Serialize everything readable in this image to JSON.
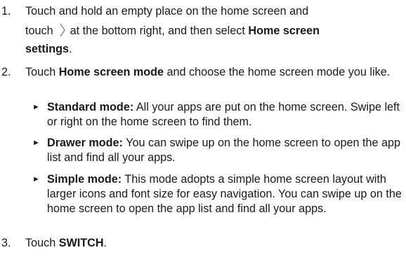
{
  "steps": [
    {
      "number": "1.",
      "line1": "Touch and hold an empty place on the home screen and",
      "pre_icon": "touch",
      "icon": "chevron-right-icon",
      "post_icon": "at the bottom right, and then select",
      "bold1": "Home screen",
      "bold2": "settings",
      "end": "."
    },
    {
      "number": "2.",
      "pre": "Touch",
      "bold": "Home screen mode",
      "post": "and choose the home screen mode you like."
    },
    {
      "number": "3.",
      "pre": "Touch",
      "bold": "SWITCH",
      "end": "."
    }
  ],
  "modes": [
    {
      "marker": "►",
      "name": "Standard mode:",
      "desc": "All your apps are put on the home screen. Swipe left or right on the home screen to find them."
    },
    {
      "marker": "►",
      "name": "Drawer mode:",
      "desc": "You can swipe up on the home screen to open the app list and find all your apps."
    },
    {
      "marker": "►",
      "name": "Simple mode:",
      "desc": "This mode adopts a simple home screen layout with larger icons and font size for easy navigation. You can swipe up on the home screen to open the app list and find all your apps."
    }
  ]
}
